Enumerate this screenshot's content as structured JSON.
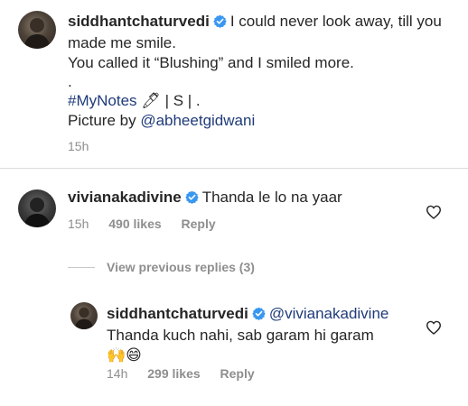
{
  "post": {
    "username": "siddhantchaturvedi",
    "caption_line1": "I could never look away, till you",
    "caption_line2": "made me smile.",
    "caption_line3": "You called it “Blushing” and I smiled more.",
    "caption_dot": ".",
    "hashtag": "#MyNotes",
    "pen_emoji": "🖊",
    "caption_suffix": " | S | .",
    "credit_prefix": "Picture by ",
    "credit_mention": "@abheetgidwani",
    "time": "15h"
  },
  "comment": {
    "username": "vivianakadivine",
    "text": "Thanda le lo na yaar",
    "time": "15h",
    "likes": "490 likes",
    "reply_label": "Reply"
  },
  "view_replies_label": "View previous replies (3)",
  "reply": {
    "username": "siddhantchaturvedi",
    "mention": "@vivianakadivine",
    "text": "Thanda kuch nahi, sab garam hi garam",
    "emojis": "🙌😄",
    "time": "14h",
    "likes": "299 likes",
    "reply_label": "Reply"
  },
  "colors": {
    "verified": "#3897f0",
    "link": "#1f3b7a",
    "muted": "#8e8e8e"
  },
  "icons": {
    "verified": "verified-badge-icon",
    "like": "heart-outline-icon"
  }
}
